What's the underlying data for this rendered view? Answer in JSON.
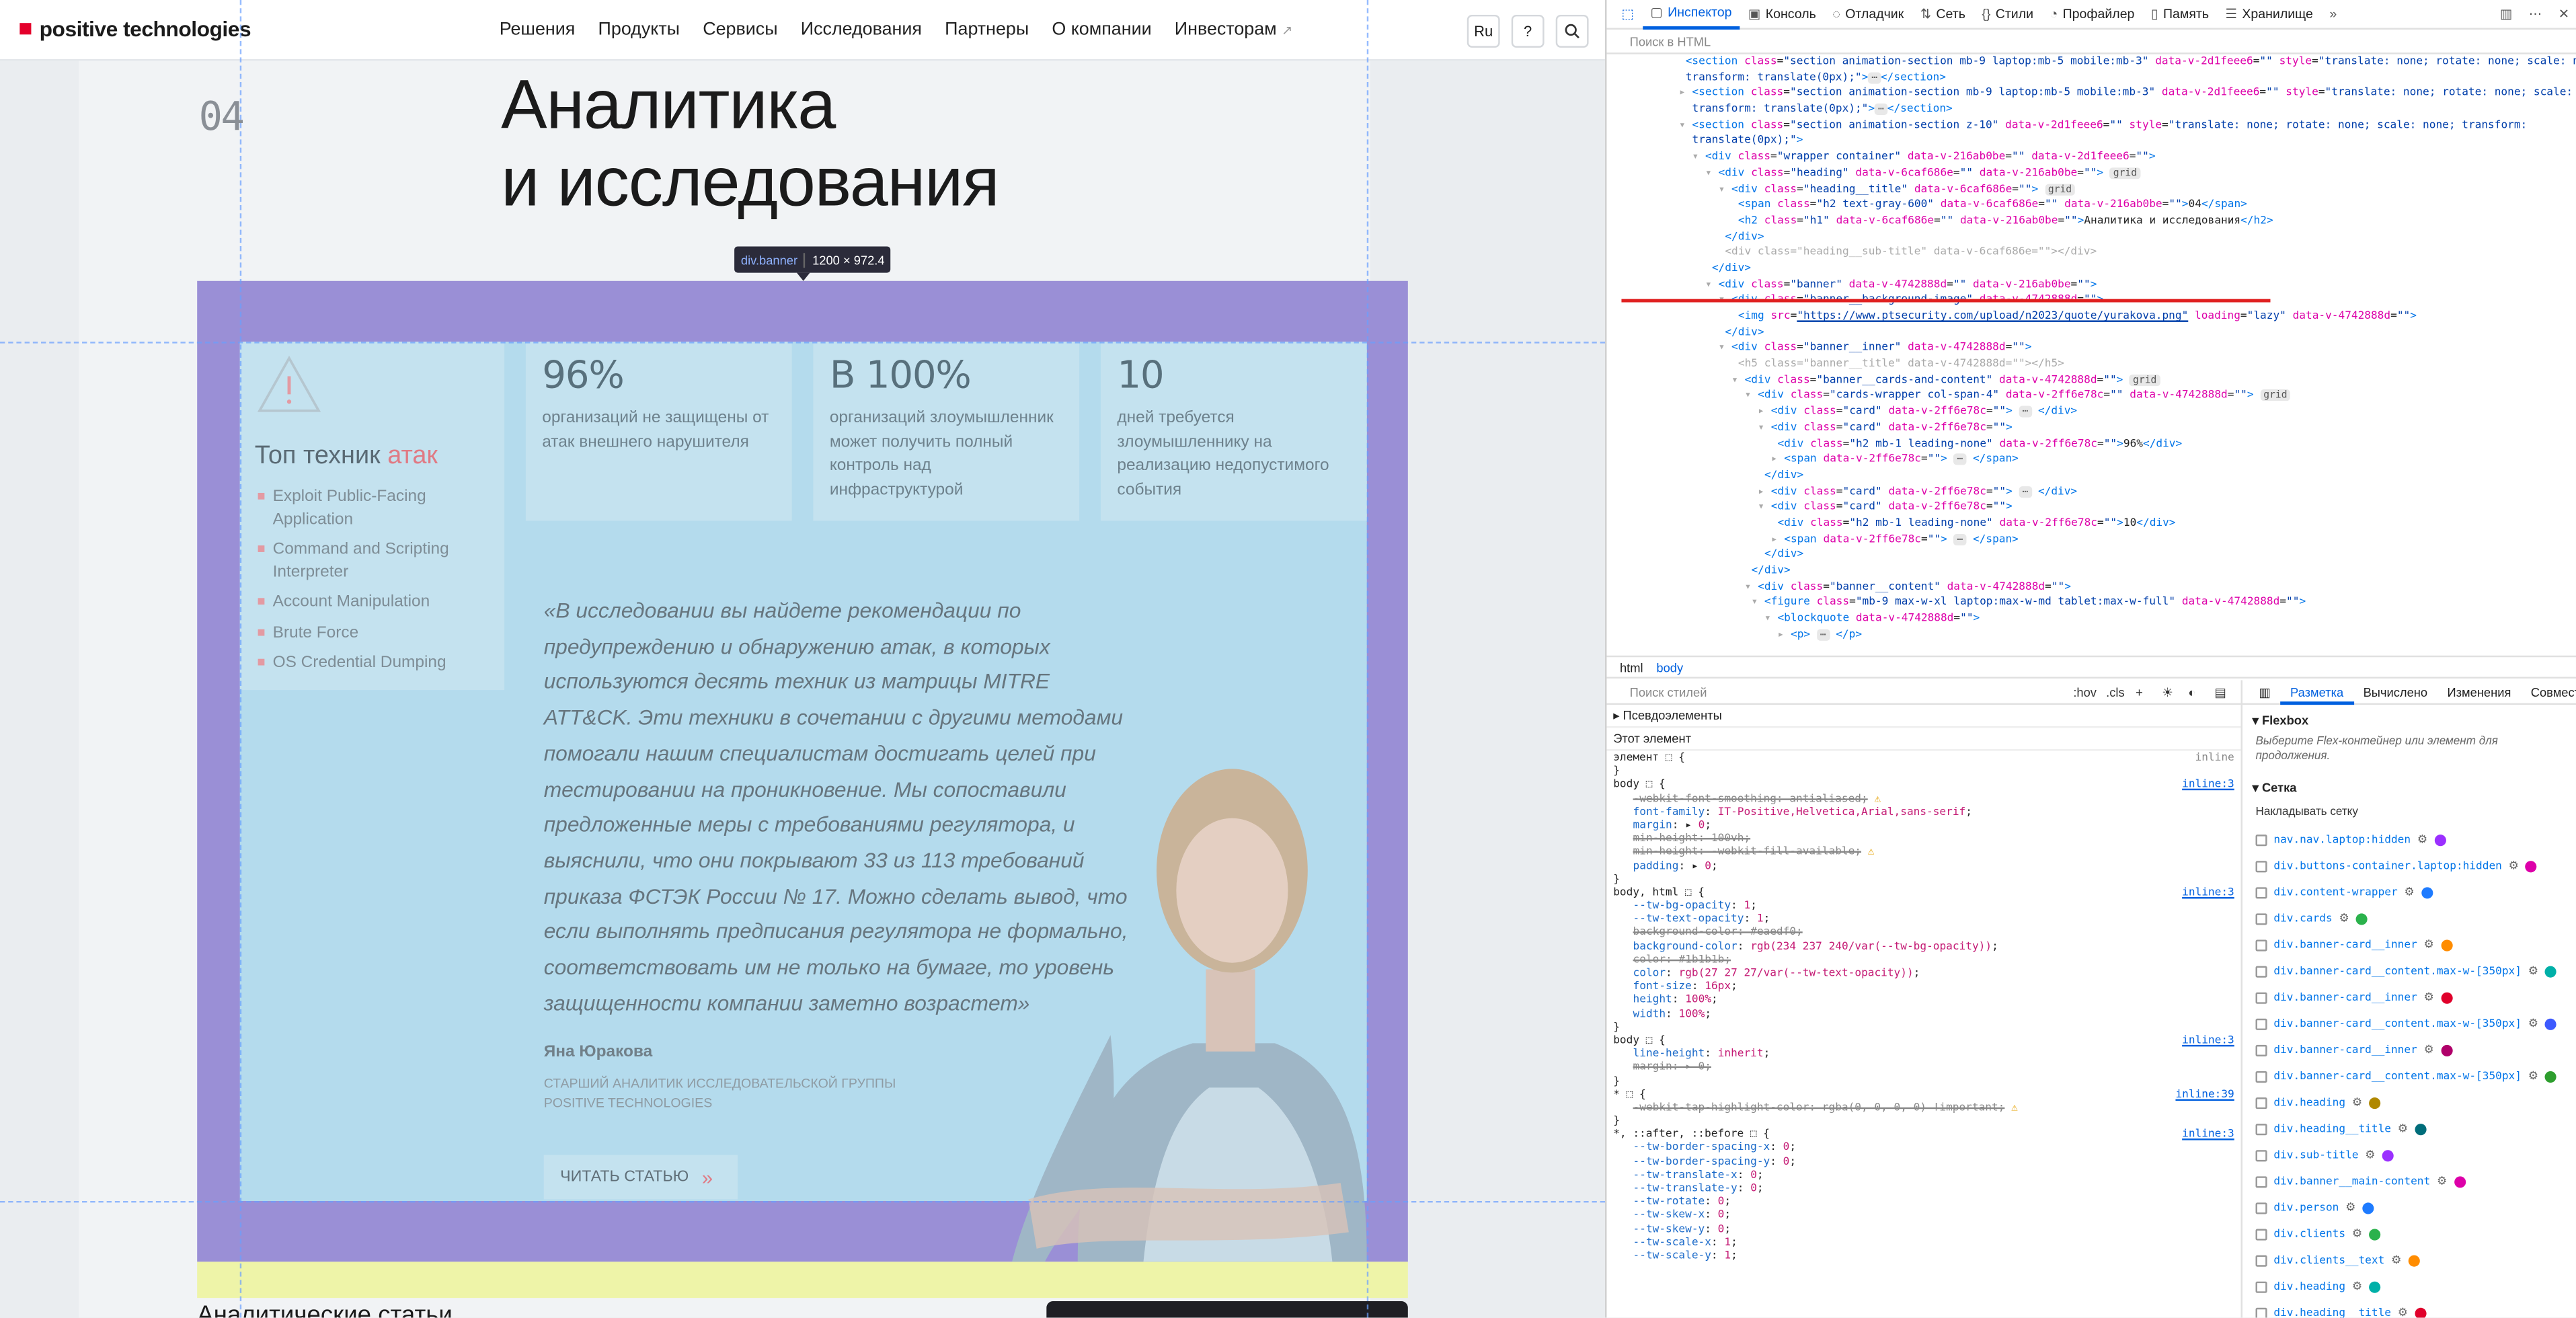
{
  "site": {
    "logo": "positive technologies",
    "nav": [
      "Решения",
      "Продукты",
      "Сервисы",
      "Исследования",
      "Партнеры",
      "О компании",
      "Инвесторам"
    ],
    "nav_ext": "↗",
    "lang_button": "Ru",
    "help_button": "?",
    "search_icon": "search-icon",
    "section_number": "04",
    "heading_line1": "Аналитика",
    "heading_line2": "и исследования",
    "inspector_tooltip": {
      "element": "div.banner",
      "size": "1200 × 972.4"
    },
    "techniques": {
      "title_prefix": "Топ техник",
      "title_accent": "атак",
      "items": [
        "Exploit Public-Facing Application",
        "Command and Scripting Interpreter",
        "Account Manipulation",
        "Brute Force",
        "OS Credential Dumping"
      ]
    },
    "stats": [
      {
        "value": "96%",
        "desc": "организаций не защищены от атак внешнего нарушителя"
      },
      {
        "value": "В 100%",
        "desc": "организаций злоумышленник может получить полный контроль над инфраструктурой"
      },
      {
        "value": "10",
        "desc": "дней требуется злоумышленнику на реализацию недопустимого события"
      }
    ],
    "quote": "«В исследовании вы найдете рекомендации по предупреждению и обнаружению атак, в которых используются десять техник из матрицы MITRE ATT&CK. Эти техники в сочетании с другими методами помогали нашим специалистам достигать целей при тестировании на проникновение. Мы сопоставили предложенные меры с требованиями регулятора, и выяснили, что они покрывают 33 из 113 требований приказа ФСТЭК России № 17. Можно сделать вывод, что если выполнять предписания регулятора не формально, соответствовать им не только на бумаге, то уровень защищенности компании заметно возрастет»",
    "author_name": "Яна Юракова",
    "author_role": "СТАРШИЙ АНАЛИТИК ИССЛЕДОВАТЕЛЬСКОЙ ГРУППЫ POSITIVE TECHNOLOGIES",
    "read_button": "ЧИТАТЬ СТАТЬЮ",
    "bottom_title": "Аналитические статьи"
  },
  "devtools": {
    "tabs": [
      "Инспектор",
      "Консоль",
      "Отладчик",
      "Сеть",
      "Стили",
      "Профайлер",
      "Память",
      "Хранилище"
    ],
    "html_search_placeholder": "Поиск в HTML",
    "breadcrumb": [
      "html",
      "body"
    ],
    "styles_search_placeholder": "Поиск стилей",
    "styles_toolbar": [
      ":hov",
      ".cls"
    ],
    "layout_tabs": [
      "Разметка",
      "Вычислено",
      "Изменения",
      "Совмест"
    ],
    "flexbox_title": "Flexbox",
    "flexbox_hint": "Выберите Flex-контейнер или элемент для продолжения.",
    "grid_title": "Сетка",
    "overlay_grid_title": "Накладывать сетку",
    "grid_items": [
      {
        "name": "nav.nav.laptop:hidden",
        "color": "#9b30ff"
      },
      {
        "name": "div.buttons-container.laptop:hidden",
        "color": "#dd00a9"
      },
      {
        "name": "div.content-wrapper",
        "color": "#1e7bff"
      },
      {
        "name": "div.cards",
        "color": "#2bb24c"
      },
      {
        "name": "div.banner-card__inner",
        "color": "#ff8c00"
      },
      {
        "name": "div.banner-card__content.max-w-[350px]",
        "color": "#00b0a8"
      },
      {
        "name": "div.banner-card__inner",
        "color": "#e0002b"
      },
      {
        "name": "div.banner-card__content.max-w-[350px]",
        "color": "#3d5afe"
      },
      {
        "name": "div.banner-card__inner",
        "color": "#b0006a"
      },
      {
        "name": "div.banner-card__content.max-w-[350px]",
        "color": "#2e9e2e"
      },
      {
        "name": "div.heading",
        "color": "#b08800"
      },
      {
        "name": "div.heading__title",
        "color": "#006d7a"
      },
      {
        "name": "div.sub-title",
        "color": "#9b30ff"
      },
      {
        "name": "div.banner__main-content",
        "color": "#dd00a9"
      },
      {
        "name": "div.person",
        "color": "#1e7bff"
      },
      {
        "name": "div.clients",
        "color": "#2bb24c"
      },
      {
        "name": "div.clients__text",
        "color": "#ff8c00"
      },
      {
        "name": "div.heading",
        "color": "#00b0a8"
      },
      {
        "name": "div.heading__title",
        "color": "#e0002b"
      }
    ],
    "rules_sections": [
      "Псевдоэлементы",
      "Этот элемент"
    ]
  }
}
